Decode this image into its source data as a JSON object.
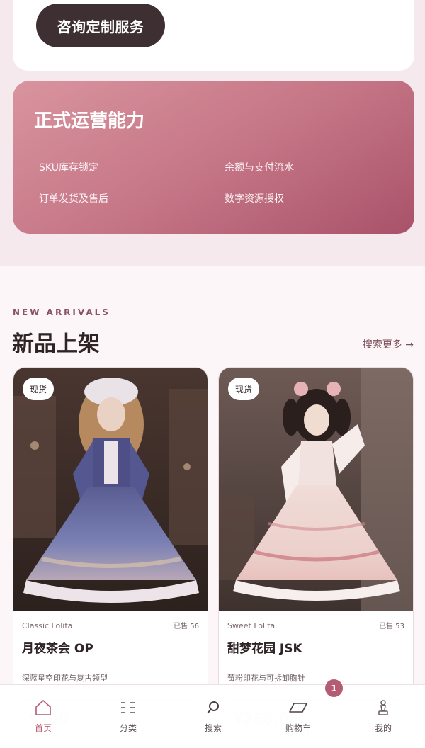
{
  "consult": {
    "label": "咨询定制服务"
  },
  "ops": {
    "title": "正式运营能力",
    "items": [
      "SKU库存锁定",
      "余额与支付流水",
      "订单发货及售后",
      "数字资源授权"
    ]
  },
  "new_arrivals": {
    "eyebrow": "NEW ARRIVALS",
    "title": "新品上架",
    "more_label": "搜索更多 →",
    "products": [
      {
        "badge": "现货",
        "category": "Classic Lolita",
        "sold": "已售 56",
        "name": "月夜茶会 OP",
        "desc": "深蓝星空印花与复古领型",
        "price": "¥ .00"
      },
      {
        "badge": "现货",
        "category": "Sweet Lolita",
        "sold": "已售 53",
        "name": "甜梦花园 JSK",
        "desc": "莓粉印花与可拆卸胸针",
        "price": "¥268.00"
      }
    ]
  },
  "nav": {
    "items": [
      {
        "label": "首页",
        "icon": "home-icon"
      },
      {
        "label": "分类",
        "icon": "grid-icon"
      },
      {
        "label": "搜索",
        "icon": "search-icon"
      },
      {
        "label": "购物车",
        "icon": "cart-icon"
      },
      {
        "label": "我的",
        "icon": "user-icon"
      }
    ],
    "cart_count": "1"
  },
  "colors": {
    "accent": "#b45c73",
    "dark_button": "#3e2f33",
    "card_gradient_start": "#d9949f",
    "card_gradient_end": "#a9526a"
  }
}
